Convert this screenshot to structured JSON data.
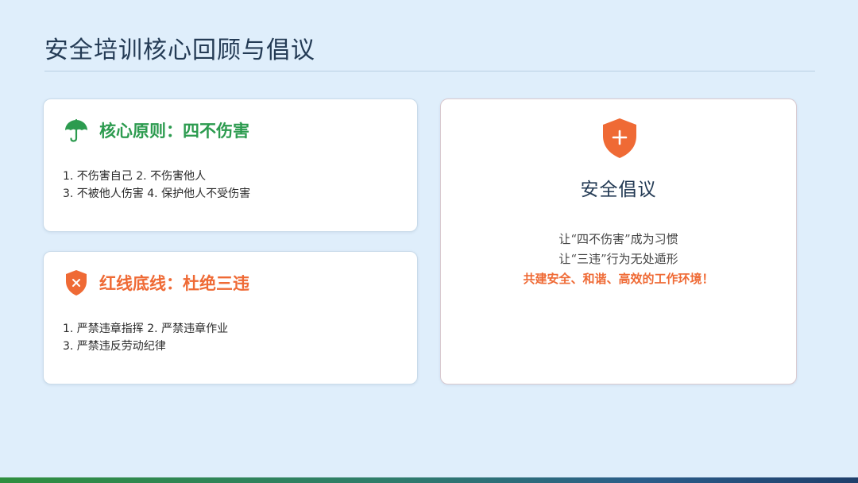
{
  "page": {
    "title": "安全培训核心回顾与倡议"
  },
  "principle_card": {
    "icon": "umbrella-icon",
    "heading": "核心原则：四不伤害",
    "line1": "1. 不伤害自己 2. 不伤害他人",
    "line2": "3. 不被他人伤害 4. 保护他人不受伤害"
  },
  "redline_card": {
    "icon": "shield-x-icon",
    "heading": "红线底线：杜绝三违",
    "line1": "1. 严禁违章指挥 2. 严禁违章作业",
    "line2": "3. 严禁违反劳动纪律"
  },
  "proposal_card": {
    "icon": "shield-plus-icon",
    "title": "安全倡议",
    "line1": "让“四不伤害”成为习惯",
    "line2": "让“三违”行为无处遁形",
    "line3": "共建安全、和谐、高效的工作环境！"
  },
  "colors": {
    "green_accent": "#2c9b4f",
    "orange_accent": "#ef6a35",
    "title_navy": "#243b55",
    "background": "#dfeefb"
  }
}
